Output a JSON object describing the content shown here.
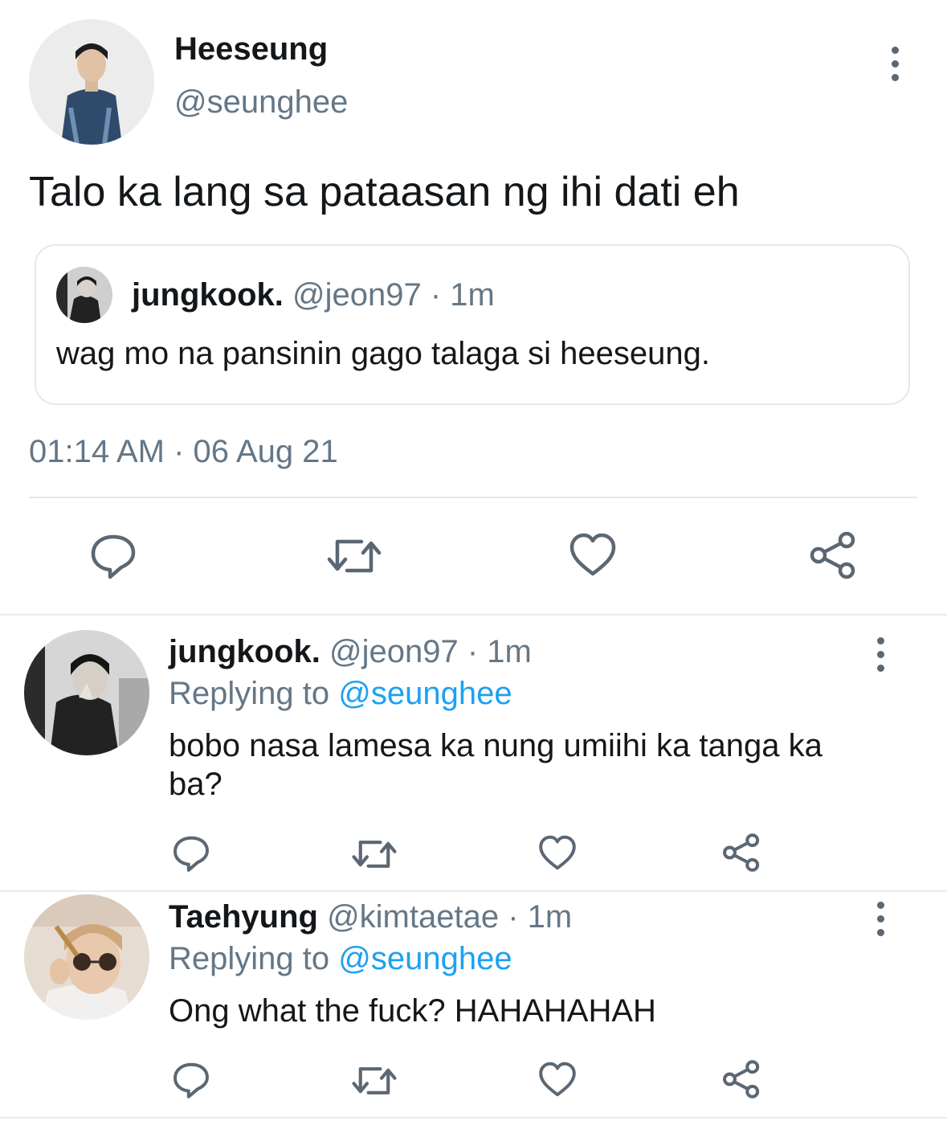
{
  "main_tweet": {
    "display_name": "Heeseung",
    "handle": "@seunghee",
    "text": "Talo ka lang sa pataasan ng ihi dati eh",
    "timestamp": "01:14 AM · 06 Aug 21",
    "quoted": {
      "display_name": "jungkook.",
      "handle": "@jeon97",
      "time": "· 1m",
      "text": "wag mo na pansinin gago talaga si heeseung."
    }
  },
  "replies": [
    {
      "display_name": "jungkook.",
      "handle": "@jeon97",
      "time": "· 1m",
      "replying_prefix": "Replying to",
      "replying_handle": "@seunghee",
      "text": "bobo nasa lamesa ka nung umiihi ka tanga ka ba?"
    },
    {
      "display_name": "Taehyung",
      "handle": "@kimtaetae",
      "time": "· 1m",
      "replying_prefix": "Replying to",
      "replying_handle": "@seunghee",
      "text": "Ong what the fuck? HAHAHAHAH"
    }
  ],
  "icons": [
    "reply-icon",
    "retweet-icon",
    "like-icon",
    "share-icon",
    "more-options-icon"
  ],
  "colors": {
    "link": "#1da1f2",
    "muted": "#657786",
    "icon": "#5b6773",
    "divider": "#e6ecf0"
  }
}
